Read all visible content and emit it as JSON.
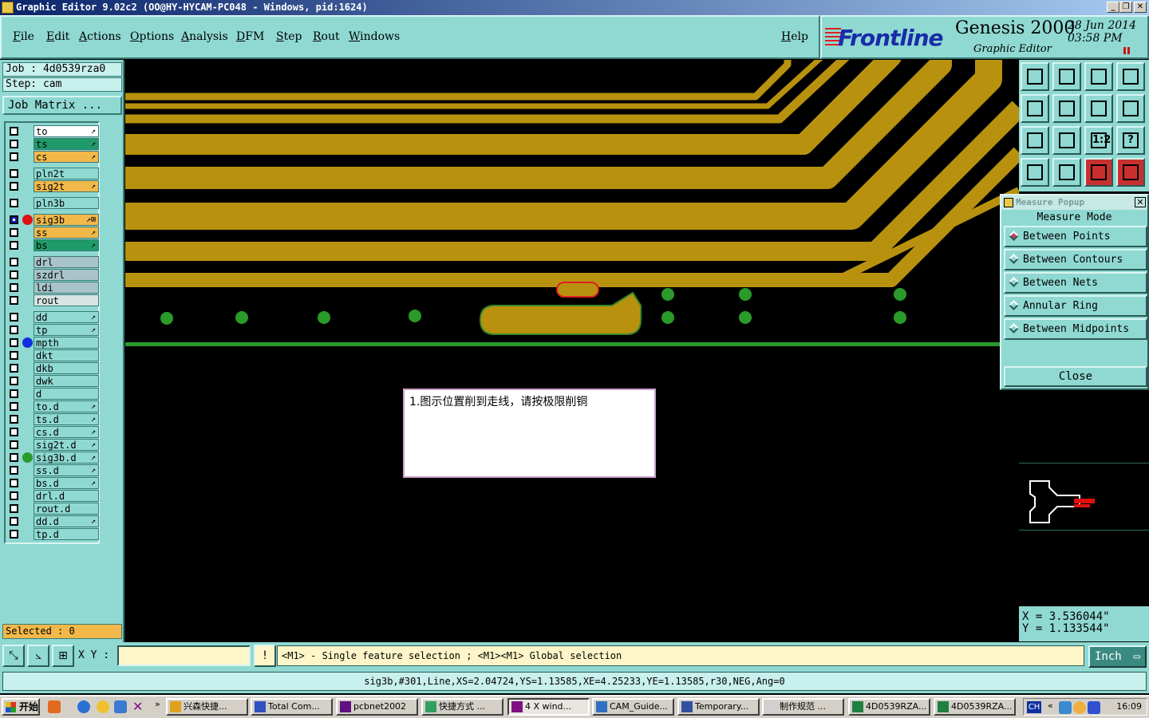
{
  "window": {
    "title": "Graphic Editor 9.02c2  (OO@HY-HYCAM-PC048 - Windows, pid:1624)"
  },
  "menu": {
    "items": [
      "File",
      "Edit",
      "Actions",
      "Options",
      "Analysis",
      "DFM",
      "Step",
      "Rout",
      "Windows"
    ],
    "help": "Help"
  },
  "brand": {
    "logo": "Frontline",
    "product": "Genesis 2000",
    "subtitle": "Graphic Editor",
    "date": "28 Jun 2014",
    "time": "03:58 PM"
  },
  "left": {
    "job": "Job : 4d0539rza0",
    "step": "Step: cam",
    "job_matrix": "Job Matrix ...",
    "selected": "Selected : 0"
  },
  "layers": [
    {
      "name": "to",
      "color": "#ffffff",
      "flag": "↗",
      "dot": ""
    },
    {
      "name": "ts",
      "color": "#1f9a6a",
      "flag": "↗",
      "dot": ""
    },
    {
      "name": "cs",
      "color": "#f2b84a",
      "flag": "↗",
      "dot": ""
    },
    {
      "name": "pln2t",
      "color": "#8fd9d2",
      "flag": "",
      "dot": ""
    },
    {
      "name": "sig2t",
      "color": "#f2b84a",
      "flag": "↗",
      "dot": ""
    },
    {
      "name": "pln3b",
      "color": "#8fd9d2",
      "flag": "",
      "dot": ""
    },
    {
      "name": "sig3b",
      "color": "#f2b84a",
      "flag": "↗⊞",
      "dot": "#e01010",
      "work": true
    },
    {
      "name": "ss",
      "color": "#f2b84a",
      "flag": "↗",
      "dot": ""
    },
    {
      "name": "bs",
      "color": "#1f9a6a",
      "flag": "↗",
      "dot": ""
    },
    {
      "name": "drl",
      "color": "#a8c4c8",
      "flag": "",
      "dot": ""
    },
    {
      "name": "szdrl",
      "color": "#a8c4c8",
      "flag": "",
      "dot": ""
    },
    {
      "name": "ldi",
      "color": "#a8c4c8",
      "flag": "",
      "dot": ""
    },
    {
      "name": "rout",
      "color": "#d8e4e4",
      "flag": "",
      "dot": ""
    },
    {
      "name": "dd",
      "color": "#8fd9d2",
      "flag": "↗",
      "dot": ""
    },
    {
      "name": "tp",
      "color": "#8fd9d2",
      "flag": "↗",
      "dot": ""
    },
    {
      "name": "mpth",
      "color": "#8fd9d2",
      "flag": "",
      "dot": "#1030e0"
    },
    {
      "name": "dkt",
      "color": "#8fd9d2",
      "flag": "",
      "dot": ""
    },
    {
      "name": "dkb",
      "color": "#8fd9d2",
      "flag": "",
      "dot": ""
    },
    {
      "name": "dwk",
      "color": "#8fd9d2",
      "flag": "",
      "dot": ""
    },
    {
      "name": "d",
      "color": "#8fd9d2",
      "flag": "",
      "dot": ""
    },
    {
      "name": "to.d",
      "color": "#8fd9d2",
      "flag": "↗",
      "dot": ""
    },
    {
      "name": "ts.d",
      "color": "#8fd9d2",
      "flag": "↗",
      "dot": ""
    },
    {
      "name": "cs.d",
      "color": "#8fd9d2",
      "flag": "↗",
      "dot": ""
    },
    {
      "name": "sig2t.d",
      "color": "#8fd9d2",
      "flag": "↗",
      "dot": ""
    },
    {
      "name": "sig3b.d",
      "color": "#8fd9d2",
      "flag": "↗",
      "dot": "#2a9a2a"
    },
    {
      "name": "ss.d",
      "color": "#8fd9d2",
      "flag": "↗",
      "dot": ""
    },
    {
      "name": "bs.d",
      "color": "#8fd9d2",
      "flag": "↗",
      "dot": ""
    },
    {
      "name": "drl.d",
      "color": "#8fd9d2",
      "flag": "",
      "dot": ""
    },
    {
      "name": "rout.d",
      "color": "#8fd9d2",
      "flag": "",
      "dot": ""
    },
    {
      "name": "dd.d",
      "color": "#8fd9d2",
      "flag": "↗",
      "dot": ""
    },
    {
      "name": "tp.d",
      "color": "#8fd9d2",
      "flag": "",
      "dot": ""
    }
  ],
  "canvas": {
    "trace_color": "#b8920e",
    "pad_color": "#2a9a2a",
    "note": "1.图示位置削到走线，请按极限削铜"
  },
  "tools": {
    "icons": [
      "tool-home-top-icon",
      "tool-home-bottom-icon",
      "tool-home-icon",
      "tool-xx-icon",
      "tool-pan-left-icon",
      "tool-pan-right-icon",
      "tool-zoom-back-icon",
      "tool-snake-icon",
      "tool-fit-icon",
      "tool-center-icon",
      "tool-scale-icon",
      "tool-help-icon",
      "tool-layers-icon",
      "tool-grid-icon",
      "tool-net-a-icon",
      "tool-net-b-icon"
    ],
    "labels": [
      "",
      "",
      "",
      "",
      "",
      "",
      "",
      "",
      "",
      "",
      "1:2",
      "?",
      "",
      "",
      "",
      ""
    ]
  },
  "measure": {
    "title": "Measure Popup",
    "mode_label": "Measure Mode",
    "options": [
      "Between Points",
      "Between Contours",
      "Between Nets",
      "Annular Ring",
      "Between Midpoints"
    ],
    "selected_index": 0,
    "close_label": "Close"
  },
  "coords": {
    "x": "X = 3.536044\"",
    "y": "Y = 1.133544\""
  },
  "command": {
    "xy_label": "X Y :",
    "xy_value": "",
    "hint": "<M1> - Single feature selection ; <M1><M1> Global selection",
    "units": "Inch"
  },
  "status": "sig3b,#301,Line,XS=2.04724,YS=1.13585,XE=4.25233,YE=1.13585,r30,NEG,Ang=0",
  "taskbar": {
    "start": "开始",
    "tasks": [
      "兴森快捷...",
      "Total Com...",
      "pcbnet2002",
      "快捷方式 ...",
      "4 X wind...",
      "CAM_Guide...",
      "Temporary...",
      "制作规范 ...",
      "4D0539RZA...",
      "4D0539RZA..."
    ],
    "active_index": 4,
    "lang": "CH",
    "clock": "16:09"
  }
}
